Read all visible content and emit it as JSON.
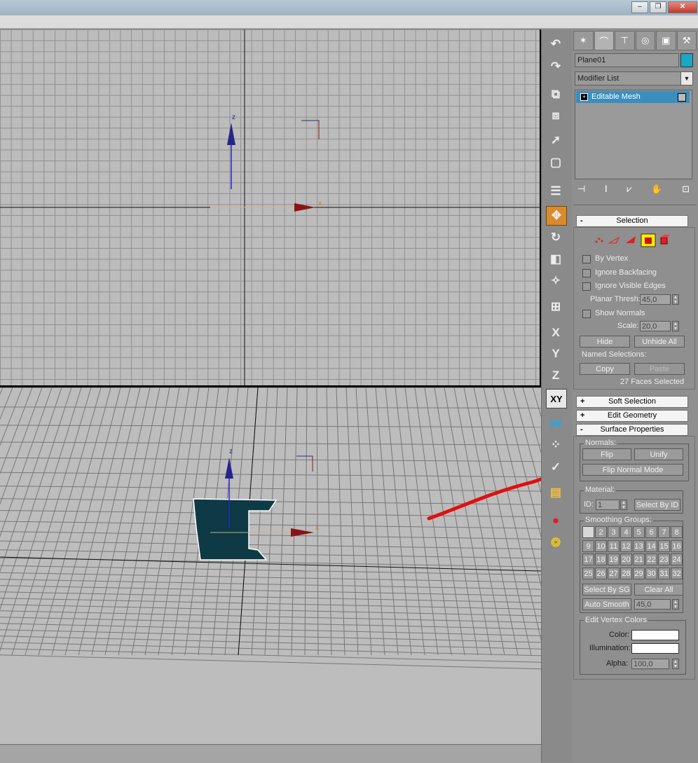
{
  "window": {
    "minimize": "–",
    "restore": "❐",
    "close": "✕"
  },
  "viewports": {
    "top_axis_z": "z",
    "top_axis_x": "x",
    "persp_axis_z": "z",
    "persp_axis_x": "x"
  },
  "toolbar": {
    "x_axis": "X",
    "y_axis": "Y",
    "z_axis": "Z",
    "xy_axis": "XY"
  },
  "command_panel": {
    "object_name": "Plane01",
    "object_color": "#1aa7c4",
    "modifier_list": "Modifier List",
    "stack_item": "Editable Mesh"
  },
  "selection": {
    "header": "Selection",
    "header_sign": "-",
    "by_vertex": "By Vertex",
    "ignore_backfacing": "Ignore Backfacing",
    "ignore_visible_edges": "Ignore Visible Edges",
    "planar_thresh_label": "Planar Thresh:",
    "planar_thresh_value": "45,0",
    "show_normals": "Show Normals",
    "scale_label": "Scale:",
    "scale_value": "20,0",
    "hide": "Hide",
    "unhide_all": "Unhide All",
    "named_selections": "Named Selections:",
    "copy": "Copy",
    "paste": "Paste",
    "status": "27 Faces Selected"
  },
  "soft_selection": {
    "header": "Soft Selection",
    "sign": "+"
  },
  "edit_geometry": {
    "header": "Edit Geometry",
    "sign": "+"
  },
  "surface_properties": {
    "header": "Surface Properties",
    "sign": "-",
    "normals_label": "Normals:",
    "flip": "Flip",
    "unify": "Unify",
    "flip_normal_mode": "Flip Normal Mode",
    "material_label": "Material:",
    "id_label": "ID:",
    "id_value": "1",
    "select_by_id": "Select By ID",
    "smoothing_groups_label": "Smoothing Groups:",
    "smoothing_groups": [
      "",
      "2",
      "3",
      "4",
      "5",
      "6",
      "7",
      "8",
      "9",
      "10",
      "11",
      "12",
      "13",
      "14",
      "15",
      "16",
      "17",
      "18",
      "19",
      "20",
      "21",
      "22",
      "23",
      "24",
      "25",
      "26",
      "27",
      "28",
      "29",
      "30",
      "31",
      "32"
    ],
    "select_by_sg": "Select By SG",
    "clear_all": "Clear All",
    "auto_smooth": "Auto Smooth",
    "auto_smooth_value": "45,0",
    "edit_vertex_colors": "Edit Vertex Colors",
    "color_label": "Color:",
    "illumination_label": "Illumination:",
    "alpha_label": "Alpha:",
    "alpha_value": "100,0"
  },
  "colors": {
    "annotation_arrow": "#e01010",
    "active_tool": "#d98a2b",
    "selected_face": "#0d3a44",
    "stack_highlight": "#3a8ebf"
  }
}
